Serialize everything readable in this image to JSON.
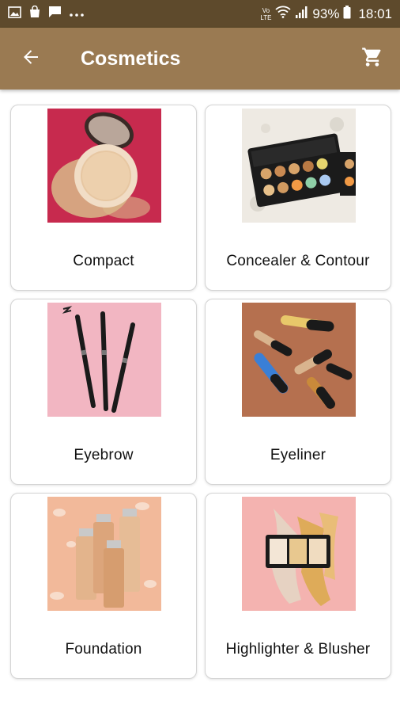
{
  "status": {
    "battery": "93%",
    "time": "18:01",
    "network": "VoLTE"
  },
  "app_bar": {
    "title": "Cosmetics"
  },
  "categories": [
    {
      "label": "Compact",
      "image": "compact-powder-image"
    },
    {
      "label": "Concealer & Contour",
      "image": "concealer-palette-image"
    },
    {
      "label": "Eyebrow",
      "image": "eyebrow-pencils-image"
    },
    {
      "label": "Eyeliner",
      "image": "eyeliner-tubes-image"
    },
    {
      "label": "Foundation",
      "image": "foundation-bottles-image"
    },
    {
      "label": "Highlighter & Blusher",
      "image": "highlighter-palette-image"
    }
  ],
  "colors": {
    "status_bar": "#5e4a2c",
    "app_bar": "#9a7a52"
  }
}
